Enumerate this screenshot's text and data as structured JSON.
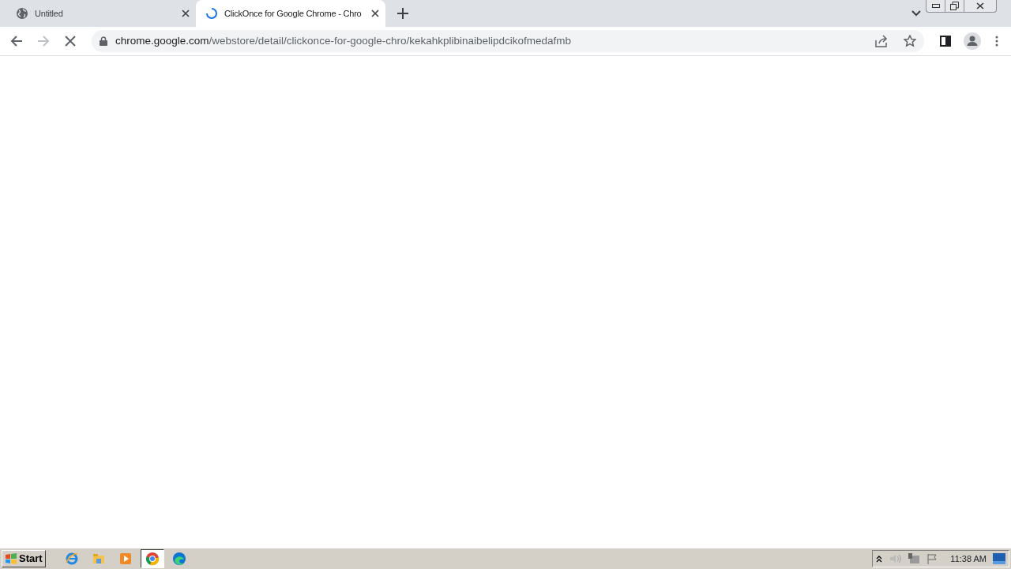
{
  "tabs": [
    {
      "title": "Untitled",
      "selected": false,
      "loading": false
    },
    {
      "title": "ClickOnce for Google Chrome - Chro",
      "selected": true,
      "loading": true
    }
  ],
  "address_bar": {
    "host": "chrome.google.com",
    "path": "/webstore/detail/clickonce-for-google-chro/kekahkplibinaibelipdcikofmedafmb"
  },
  "taskbar": {
    "start_label": "Start",
    "apps": [
      {
        "kind": "ie",
        "selected": false
      },
      {
        "kind": "folder",
        "selected": false
      },
      {
        "kind": "media",
        "selected": false
      },
      {
        "kind": "chrome",
        "selected": true
      },
      {
        "kind": "edge",
        "selected": false
      }
    ],
    "clock": "11:38 AM"
  }
}
